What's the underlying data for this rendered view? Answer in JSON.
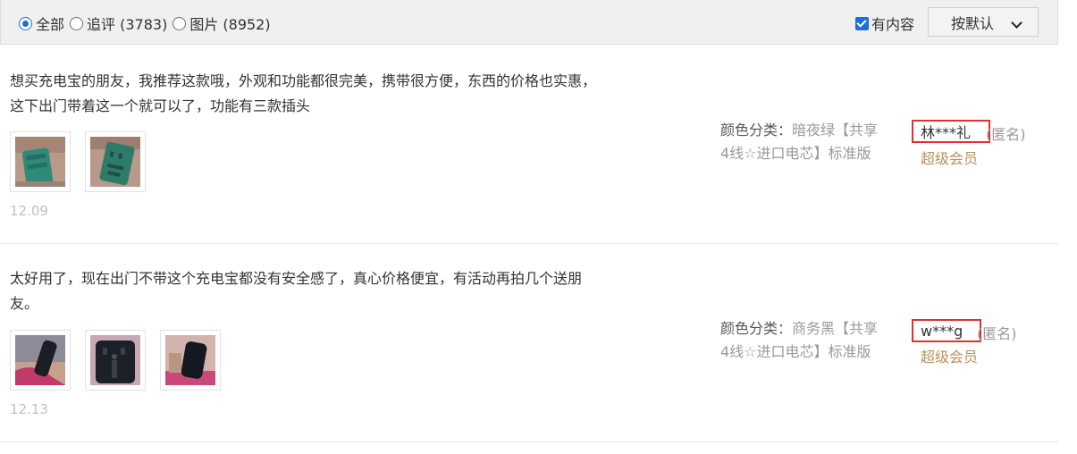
{
  "filters": {
    "options": [
      {
        "label": "全部",
        "checked": true
      },
      {
        "label": "追评 (3783)",
        "checked": false
      },
      {
        "label": "图片 (8952)",
        "checked": false
      }
    ],
    "has_content_label": "有内容",
    "has_content_checked": true,
    "sort_label": "按默认"
  },
  "reviews": [
    {
      "text_line1": "想买充电宝的朋友，我推荐这款哦，外观和功能都很完美，携带很方便，东西的价格也实惠，",
      "text_line2": "这下出门带着这一个就可以了，功能有三款插头",
      "date": "12.09",
      "sku_label": "颜色分类：",
      "sku_line1": "暗夜绿【共享",
      "sku_line2": "4线☆进口电芯】标准版",
      "user": "林***礼",
      "anon": "(匿名)",
      "vip": "超级会员",
      "photos": [
        "green-powerbank-photo",
        "green-powerbank-back-photo"
      ]
    },
    {
      "text_line1": "太好用了，现在出门不带这个充电宝都没有安全感了，真心价格便宜，有活动再拍几个送朋",
      "text_line2": "友。",
      "date": "12.13",
      "sku_label": "颜色分类：",
      "sku_line1": "商务黑【共享",
      "sku_line2": "4线☆进口电芯】标准版",
      "user": "w***g",
      "anon": "(匿名)",
      "vip": "超级会员",
      "photos": [
        "black-powerbank-hand-photo",
        "black-powerbank-cables-photo",
        "black-powerbank-photo"
      ]
    }
  ]
}
